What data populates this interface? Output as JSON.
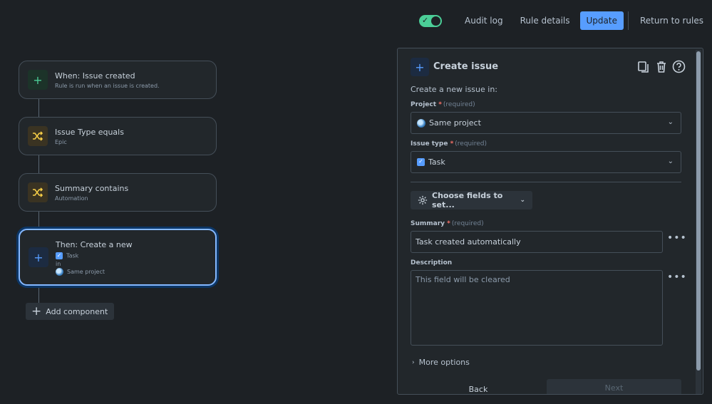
{
  "topbar": {
    "audit_log": "Audit log",
    "rule_details": "Rule details",
    "update": "Update",
    "return_to_rules": "Return to rules"
  },
  "flow": {
    "nodes": [
      {
        "title": "When: Issue created",
        "subtitle": "Rule is run when an issue is created.",
        "icon": "plus-icon"
      },
      {
        "title": "Issue Type equals",
        "subtitle": "Epic",
        "icon": "branch-shuffle-icon"
      },
      {
        "title": "Summary contains",
        "subtitle": "Automation",
        "icon": "branch-shuffle-icon"
      },
      {
        "title": "Then: Create a new",
        "line1": "Task",
        "line2": "in",
        "line3": "Same project",
        "icon": "plus-icon"
      }
    ],
    "add_component": "Add component"
  },
  "panel": {
    "title": "Create issue",
    "intro": "Create a new issue in:",
    "project_label": "Project",
    "required_hint": "(required)",
    "project_value": "Same project",
    "issue_type_label": "Issue type",
    "issue_type_value": "Task",
    "choose_fields": "Choose fields to set...",
    "summary_label": "Summary",
    "summary_value": "Task created automatically",
    "description_label": "Description",
    "description_placeholder": "This field will be cleared",
    "more_options": "More options",
    "back": "Back",
    "next": "Next"
  },
  "colors": {
    "background": "#1d2125",
    "accent": "#579dff",
    "toggle_on": "#4bce97",
    "trigger_green": "#4bce97",
    "condition_yellow": "#f5cd47"
  }
}
